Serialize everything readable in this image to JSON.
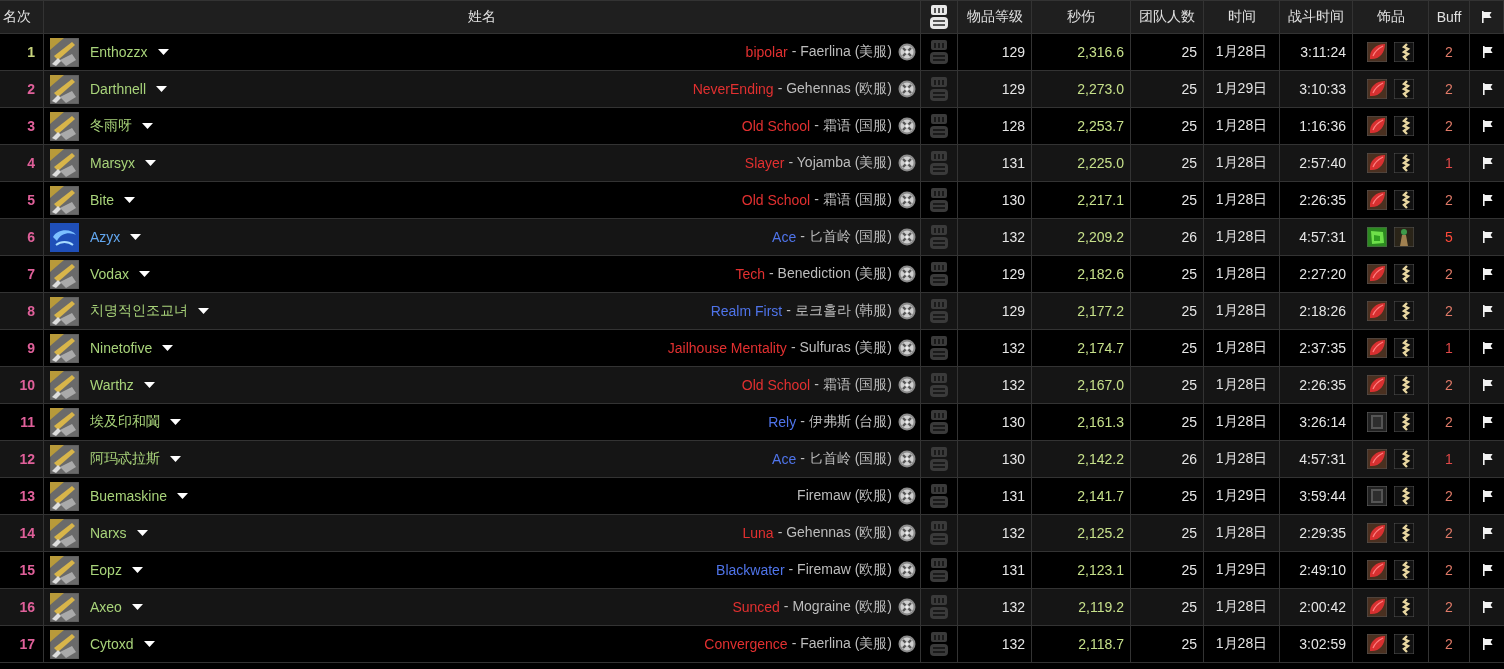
{
  "table": {
    "columns": [
      {
        "kind": "text",
        "label": "名次"
      },
      {
        "kind": "text",
        "label": "姓名"
      },
      {
        "kind": "video"
      },
      {
        "kind": "text",
        "label": "物品等级"
      },
      {
        "kind": "text",
        "label": "秒伤"
      },
      {
        "kind": "text",
        "label": "团队人数"
      },
      {
        "kind": "text",
        "label": "时间"
      },
      {
        "kind": "text",
        "label": "战斗时间"
      },
      {
        "kind": "text",
        "label": "饰品"
      },
      {
        "kind": "text",
        "label": "Buff"
      },
      {
        "kind": "flag"
      }
    ],
    "rows": [
      {
        "rank": {
          "text": "1",
          "color": "#c8d47c"
        },
        "avatar": {
          "kind": "gold"
        },
        "name": {
          "text": "Enthozzx",
          "color": "#a8d37a"
        },
        "guild": {
          "text": "bipolar",
          "color": "#e23030"
        },
        "server": "- Faerlina (美服)",
        "ilvl": "129",
        "dps": "2,316.6",
        "raid_size": "25",
        "date": "1月28日",
        "duration": "3:11:24",
        "trinkets": [
          {
            "kind": "leaf"
          },
          {
            "kind": "spine"
          }
        ],
        "buff": {
          "text": "2",
          "color": "#e07a68"
        }
      },
      {
        "rank": {
          "text": "2",
          "color": "#e0609a"
        },
        "avatar": {
          "kind": "gold"
        },
        "name": {
          "text": "Darthnell",
          "color": "#a8d37a"
        },
        "guild": {
          "text": "NeverEnding",
          "color": "#e23030"
        },
        "server": "- Gehennas (欧服)",
        "ilvl": "129",
        "dps": "2,273.0",
        "raid_size": "25",
        "date": "1月29日",
        "duration": "3:10:33",
        "trinkets": [
          {
            "kind": "leaf"
          },
          {
            "kind": "spine"
          }
        ],
        "buff": {
          "text": "2",
          "color": "#e07a68"
        }
      },
      {
        "rank": {
          "text": "3",
          "color": "#e0609a"
        },
        "avatar": {
          "kind": "gold"
        },
        "name": {
          "text": "冬雨呀",
          "color": "#a8d37a"
        },
        "guild": {
          "text": "Old School",
          "color": "#e23030"
        },
        "server": "- 霜语 (国服)",
        "ilvl": "128",
        "dps": "2,253.7",
        "raid_size": "25",
        "date": "1月28日",
        "duration": "1:16:36",
        "trinkets": [
          {
            "kind": "leaf"
          },
          {
            "kind": "spine"
          }
        ],
        "buff": {
          "text": "2",
          "color": "#e07a68"
        }
      },
      {
        "rank": {
          "text": "4",
          "color": "#e0609a"
        },
        "avatar": {
          "kind": "gold"
        },
        "name": {
          "text": "Marsyx",
          "color": "#a8d37a"
        },
        "guild": {
          "text": "Slayer",
          "color": "#e23030"
        },
        "server": "- Yojamba (美服)",
        "ilvl": "131",
        "dps": "2,225.0",
        "raid_size": "25",
        "date": "1月28日",
        "duration": "2:57:40",
        "trinkets": [
          {
            "kind": "leaf"
          },
          {
            "kind": "spine"
          }
        ],
        "buff": {
          "text": "1",
          "color": "#e04848"
        }
      },
      {
        "rank": {
          "text": "5",
          "color": "#e0609a"
        },
        "avatar": {
          "kind": "gold"
        },
        "name": {
          "text": "Bite",
          "color": "#a8d37a"
        },
        "guild": {
          "text": "Old School",
          "color": "#e23030"
        },
        "server": "- 霜语 (国服)",
        "ilvl": "130",
        "dps": "2,217.1",
        "raid_size": "25",
        "date": "1月28日",
        "duration": "2:26:35",
        "trinkets": [
          {
            "kind": "leaf"
          },
          {
            "kind": "spine"
          }
        ],
        "buff": {
          "text": "2",
          "color": "#e07a68"
        }
      },
      {
        "rank": {
          "text": "6",
          "color": "#e0609a"
        },
        "avatar": {
          "kind": "blue"
        },
        "name": {
          "text": "Azyx",
          "color": "#62a6ee"
        },
        "guild": {
          "text": "Ace",
          "color": "#4f74ea"
        },
        "server": "- 匕首岭 (国服)",
        "ilvl": "132",
        "dps": "2,209.2",
        "raid_size": "26",
        "date": "1月28日",
        "duration": "4:57:31",
        "trinkets": [
          {
            "kind": "emerald"
          },
          {
            "kind": "figure"
          }
        ],
        "buff": {
          "text": "5",
          "color": "#ff4a3a"
        }
      },
      {
        "rank": {
          "text": "7",
          "color": "#e0609a"
        },
        "avatar": {
          "kind": "gold"
        },
        "name": {
          "text": "Vodax",
          "color": "#a8d37a"
        },
        "guild": {
          "text": "Tech",
          "color": "#e23030"
        },
        "server": "- Benediction (美服)",
        "ilvl": "129",
        "dps": "2,182.6",
        "raid_size": "25",
        "date": "1月28日",
        "duration": "2:27:20",
        "trinkets": [
          {
            "kind": "leaf"
          },
          {
            "kind": "spine"
          }
        ],
        "buff": {
          "text": "2",
          "color": "#e07a68"
        }
      },
      {
        "rank": {
          "text": "8",
          "color": "#e0609a"
        },
        "avatar": {
          "kind": "gold"
        },
        "name": {
          "text": "치명적인조교녀",
          "color": "#a8d37a"
        },
        "guild": {
          "text": "Realm First",
          "color": "#4f74ea"
        },
        "server": "- 로크홀라 (韩服)",
        "ilvl": "129",
        "dps": "2,177.2",
        "raid_size": "25",
        "date": "1月28日",
        "duration": "2:18:26",
        "trinkets": [
          {
            "kind": "leaf"
          },
          {
            "kind": "spine"
          }
        ],
        "buff": {
          "text": "2",
          "color": "#e07a68"
        }
      },
      {
        "rank": {
          "text": "9",
          "color": "#e0609a"
        },
        "avatar": {
          "kind": "gold"
        },
        "name": {
          "text": "Ninetofive",
          "color": "#a8d37a"
        },
        "guild": {
          "text": "Jailhouse Mentality",
          "color": "#e23030"
        },
        "server": "- Sulfuras (美服)",
        "ilvl": "132",
        "dps": "2,174.7",
        "raid_size": "25",
        "date": "1月28日",
        "duration": "2:37:35",
        "trinkets": [
          {
            "kind": "leaf"
          },
          {
            "kind": "spine"
          }
        ],
        "buff": {
          "text": "1",
          "color": "#e04848"
        }
      },
      {
        "rank": {
          "text": "10",
          "color": "#e0609a"
        },
        "avatar": {
          "kind": "gold"
        },
        "name": {
          "text": "Warthz",
          "color": "#a8d37a"
        },
        "guild": {
          "text": "Old School",
          "color": "#e23030"
        },
        "server": "- 霜语 (国服)",
        "ilvl": "132",
        "dps": "2,167.0",
        "raid_size": "25",
        "date": "1月28日",
        "duration": "2:26:35",
        "trinkets": [
          {
            "kind": "leaf"
          },
          {
            "kind": "spine"
          }
        ],
        "buff": {
          "text": "2",
          "color": "#e07a68"
        }
      },
      {
        "rank": {
          "text": "11",
          "color": "#e0609a"
        },
        "avatar": {
          "kind": "gold"
        },
        "name": {
          "text": "埃及印和闐",
          "color": "#a8d37a"
        },
        "guild": {
          "text": "Rely",
          "color": "#4f74ea"
        },
        "server": "- 伊弗斯 (台服)",
        "ilvl": "130",
        "dps": "2,161.3",
        "raid_size": "25",
        "date": "1月28日",
        "duration": "3:26:14",
        "trinkets": [
          {
            "kind": "slab"
          },
          {
            "kind": "spine"
          }
        ],
        "buff": {
          "text": "2",
          "color": "#e07a68"
        }
      },
      {
        "rank": {
          "text": "12",
          "color": "#e0609a"
        },
        "avatar": {
          "kind": "gold"
        },
        "name": {
          "text": "阿玛忒拉斯",
          "color": "#a8d37a"
        },
        "guild": {
          "text": "Ace",
          "color": "#4f74ea"
        },
        "server": "- 匕首岭 (国服)",
        "ilvl": "130",
        "dps": "2,142.2",
        "raid_size": "26",
        "date": "1月28日",
        "duration": "4:57:31",
        "trinkets": [
          {
            "kind": "leaf"
          },
          {
            "kind": "spine"
          }
        ],
        "buff": {
          "text": "1",
          "color": "#e04848"
        }
      },
      {
        "rank": {
          "text": "13",
          "color": "#e0609a"
        },
        "avatar": {
          "kind": "gold"
        },
        "name": {
          "text": "Buemaskine",
          "color": "#a8d37a"
        },
        "server": "Firemaw (欧服)",
        "ilvl": "131",
        "dps": "2,141.7",
        "raid_size": "25",
        "date": "1月29日",
        "duration": "3:59:44",
        "trinkets": [
          {
            "kind": "slab"
          },
          {
            "kind": "spine"
          }
        ],
        "buff": {
          "text": "2",
          "color": "#e07a68"
        }
      },
      {
        "rank": {
          "text": "14",
          "color": "#e0609a"
        },
        "avatar": {
          "kind": "gold"
        },
        "name": {
          "text": "Narxs",
          "color": "#a8d37a"
        },
        "guild": {
          "text": "Luna",
          "color": "#e23030"
        },
        "server": "- Gehennas (欧服)",
        "ilvl": "132",
        "dps": "2,125.2",
        "raid_size": "25",
        "date": "1月28日",
        "duration": "2:29:35",
        "trinkets": [
          {
            "kind": "leaf"
          },
          {
            "kind": "spine"
          }
        ],
        "buff": {
          "text": "2",
          "color": "#e07a68"
        }
      },
      {
        "rank": {
          "text": "15",
          "color": "#e0609a"
        },
        "avatar": {
          "kind": "gold"
        },
        "name": {
          "text": "Eopz",
          "color": "#a8d37a"
        },
        "guild": {
          "text": "Blackwater",
          "color": "#4f74ea"
        },
        "server": "- Firemaw (欧服)",
        "ilvl": "131",
        "dps": "2,123.1",
        "raid_size": "25",
        "date": "1月29日",
        "duration": "2:49:10",
        "trinkets": [
          {
            "kind": "leaf"
          },
          {
            "kind": "spine"
          }
        ],
        "buff": {
          "text": "2",
          "color": "#e07a68"
        }
      },
      {
        "rank": {
          "text": "16",
          "color": "#e0609a"
        },
        "avatar": {
          "kind": "gold"
        },
        "name": {
          "text": "Axeo",
          "color": "#a8d37a"
        },
        "guild": {
          "text": "Sunced",
          "color": "#e23030"
        },
        "server": "- Mograine (欧服)",
        "ilvl": "132",
        "dps": "2,119.2",
        "raid_size": "25",
        "date": "1月28日",
        "duration": "2:00:42",
        "trinkets": [
          {
            "kind": "leaf"
          },
          {
            "kind": "spine"
          }
        ],
        "buff": {
          "text": "2",
          "color": "#e07a68"
        }
      },
      {
        "rank": {
          "text": "17",
          "color": "#e0609a"
        },
        "avatar": {
          "kind": "gold"
        },
        "name": {
          "text": "Cytoxd",
          "color": "#a8d37a"
        },
        "guild": {
          "text": "Convergence",
          "color": "#e23030"
        },
        "server": "- Faerlina (美服)",
        "ilvl": "132",
        "dps": "2,118.7",
        "raid_size": "25",
        "date": "1月28日",
        "duration": "3:02:59",
        "trinkets": [
          {
            "kind": "leaf"
          },
          {
            "kind": "spine"
          }
        ],
        "buff": {
          "text": "2",
          "color": "#e07a68"
        }
      }
    ]
  }
}
